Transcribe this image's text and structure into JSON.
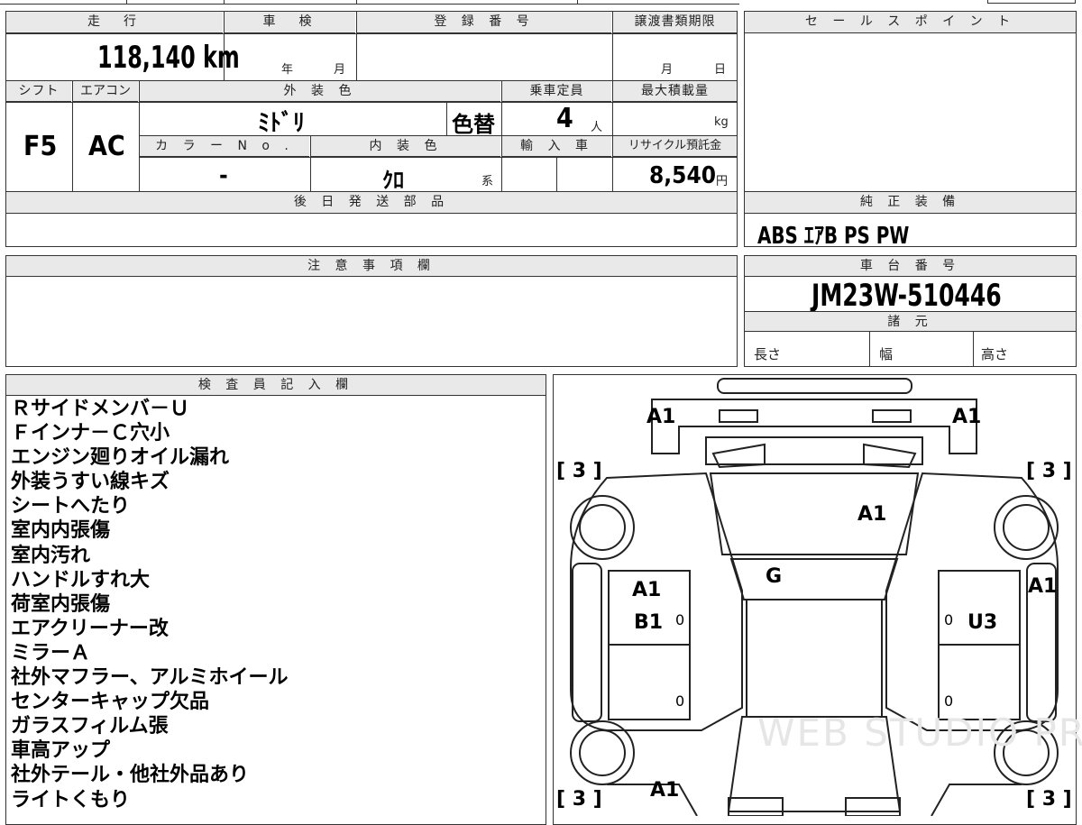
{
  "labels": {
    "mileage": "走　行",
    "inspection": "車　検",
    "registration": "登 録 番 号",
    "transfer_deadline": "譲渡書類期限",
    "sale_points": "セ ー ル ス ポ イ ン ト",
    "shift": "シフト",
    "aircon": "エアコン",
    "exterior_color": "外 装 色",
    "capacity": "乗車定員",
    "max_load": "最大積載量",
    "color_no": "カ ラ ー N o .",
    "interior_color": "内 装 色",
    "import_car": "輸 入 車",
    "recycle_fee": "リサイクル預託金",
    "later_parts": "後 日 発 送 部 品",
    "genuine_equipment": "純 正 装 備",
    "caution": "注 意 事 項 欄",
    "chassis_no": "車 台 番 号",
    "specs": "諸 元",
    "length": "長さ",
    "width": "幅",
    "height": "高さ",
    "inspector": "検 査 員 記 入 欄",
    "year_unit": "年",
    "month_unit": "月",
    "day_unit": "日",
    "kg_unit": "kg",
    "person_unit": "人",
    "yen_unit": "円",
    "series_unit": "系"
  },
  "values": {
    "mileage": "118,140 km",
    "shift": "F5",
    "aircon": "AC",
    "exterior_color": "ﾐﾄﾞﾘ",
    "color_change": "色替",
    "capacity": "4",
    "color_no": "-",
    "interior_color": "ｸﾛ",
    "recycle_fee": "8,540",
    "genuine_equipment": "ABS  ｴｱB  PS  PW",
    "chassis_no": "JM23W-510446"
  },
  "remarks": [
    "Ｒサイドメンバ－Ｕ",
    "Ｆインナ－Ｃ穴小",
    "エンジン廻りオイル漏れ",
    "外装うすい線キズ",
    "シートへたり",
    "室内内張傷",
    "室内汚れ",
    "ハンドルすれ大",
    "荷室内張傷",
    "エアクリーナー改",
    "ミラーＡ",
    "社外マフラー、アルミホイール",
    "センターキャップ欠品",
    "ガラスフィルム張",
    "車高アップ",
    "社外テール・他社外品あり",
    "ライトくもり"
  ],
  "diagram": {
    "front_left": "A1",
    "front_right": "A1",
    "tire_fl": "[ 3 ]",
    "tire_fr": "[ 3 ]",
    "tire_rl": "[ 3 ]",
    "tire_rr": "[ 3 ]",
    "hood": "A1",
    "windshield": "G",
    "right_fender": "A1",
    "left_door_a": "A1",
    "left_door_b": "B1",
    "right_door": "U3",
    "rear": "A1",
    "pillar_zero": "0",
    "watermark": "WEB STUDIO PRO"
  }
}
